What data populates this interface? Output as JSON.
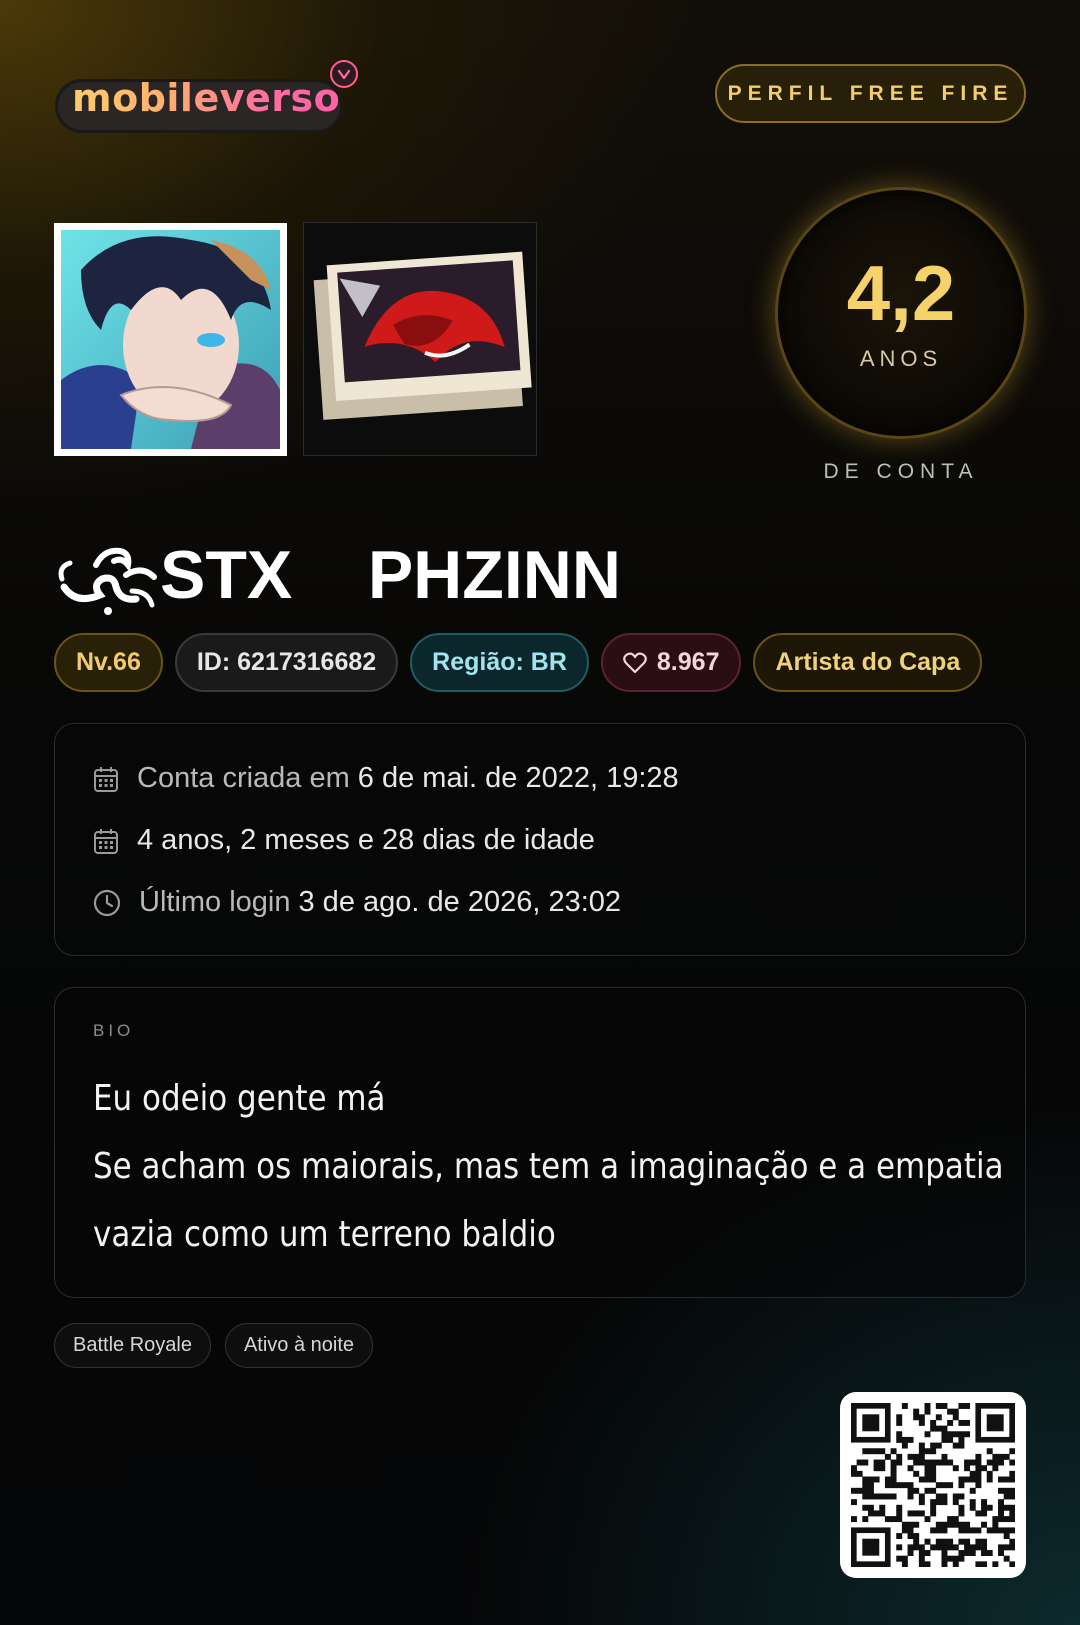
{
  "header": {
    "logo_text": "mobileverso",
    "logo_icon": "heart-badge-icon",
    "profile_button_label": "PERFIL FREE FIRE"
  },
  "account_age": {
    "value": "4,2",
    "unit": "ANOS",
    "caption": "DE CONTA"
  },
  "player": {
    "name_prefix_icon": "ornament-swirl-icon",
    "name": "STX    PHZINN"
  },
  "chips": {
    "level": "Nv.66",
    "id": "ID: 6217316682",
    "region": "Região: BR",
    "likes": "8.967",
    "likes_icon": "heart-outline-icon",
    "title": "Artista do Capa"
  },
  "info": {
    "created_label": "Conta criada em",
    "created_value": "6 de mai. de 2022, 19:28",
    "age_text": "4 anos, 2 meses e 28 dias de idade",
    "last_login_label": "Último login",
    "last_login_value": "3 de ago. de 2026, 23:02"
  },
  "bio": {
    "label": "BIO",
    "lines": [
      "Eu odeio gente má",
      "Se acham os maiorais, mas tem a imaginação e a empatia",
      "vazia como um terreno baldio"
    ]
  },
  "tags": [
    "Battle Royale",
    "Ativo à noite"
  ],
  "colors": {
    "gold": "#f5d36a",
    "teal": "#9fe4ee",
    "pink": "#ff5f8f"
  }
}
